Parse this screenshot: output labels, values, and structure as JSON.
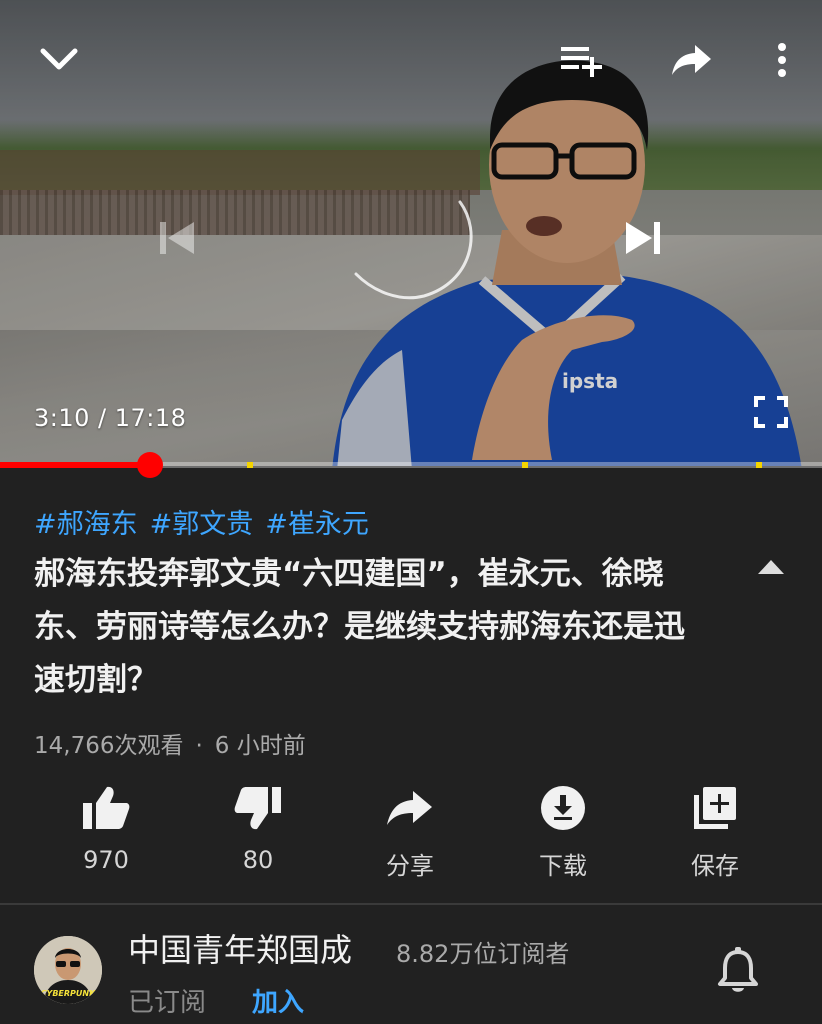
{
  "player": {
    "current_time": "3:10",
    "duration": "17:18",
    "time_separator": " / ",
    "progress_fraction": 0.183,
    "chapter_marks": [
      0.3,
      0.635,
      0.92
    ],
    "jersey_text": "ipsta"
  },
  "video": {
    "hashtags": [
      "#郝海东",
      "#郭文贵",
      "#崔永元"
    ],
    "title": "郝海东投奔郭文贵“六四建国”，崔永元、徐晓东、劳丽诗等怎么办？是继续支持郝海东还是迅速切割？",
    "views": "14,766次观看",
    "age": "6 小时前",
    "meta_separator": "·"
  },
  "actions": {
    "like": "970",
    "dislike": "80",
    "share": "分享",
    "download": "下载",
    "save": "保存"
  },
  "channel": {
    "name": "中国青年郑国成",
    "subscribers": "8.82万位订阅者",
    "subscribed_label": "已订阅",
    "join_label": "加入",
    "avatar_text": "CYBERPUNK"
  },
  "colors": {
    "background": "#212121",
    "accent_blue": "#3ea6ff",
    "progress_red": "#ff0000",
    "chapter_yellow": "#f4d400"
  },
  "icons": [
    "chevron-down-icon",
    "add-to-queue-icon",
    "share-icon",
    "more-vert-icon",
    "previous-icon",
    "next-icon",
    "fullscreen-icon",
    "chevron-up-icon",
    "thumb-up-icon",
    "thumb-down-icon",
    "download-icon",
    "library-add-icon",
    "bell-icon"
  ]
}
